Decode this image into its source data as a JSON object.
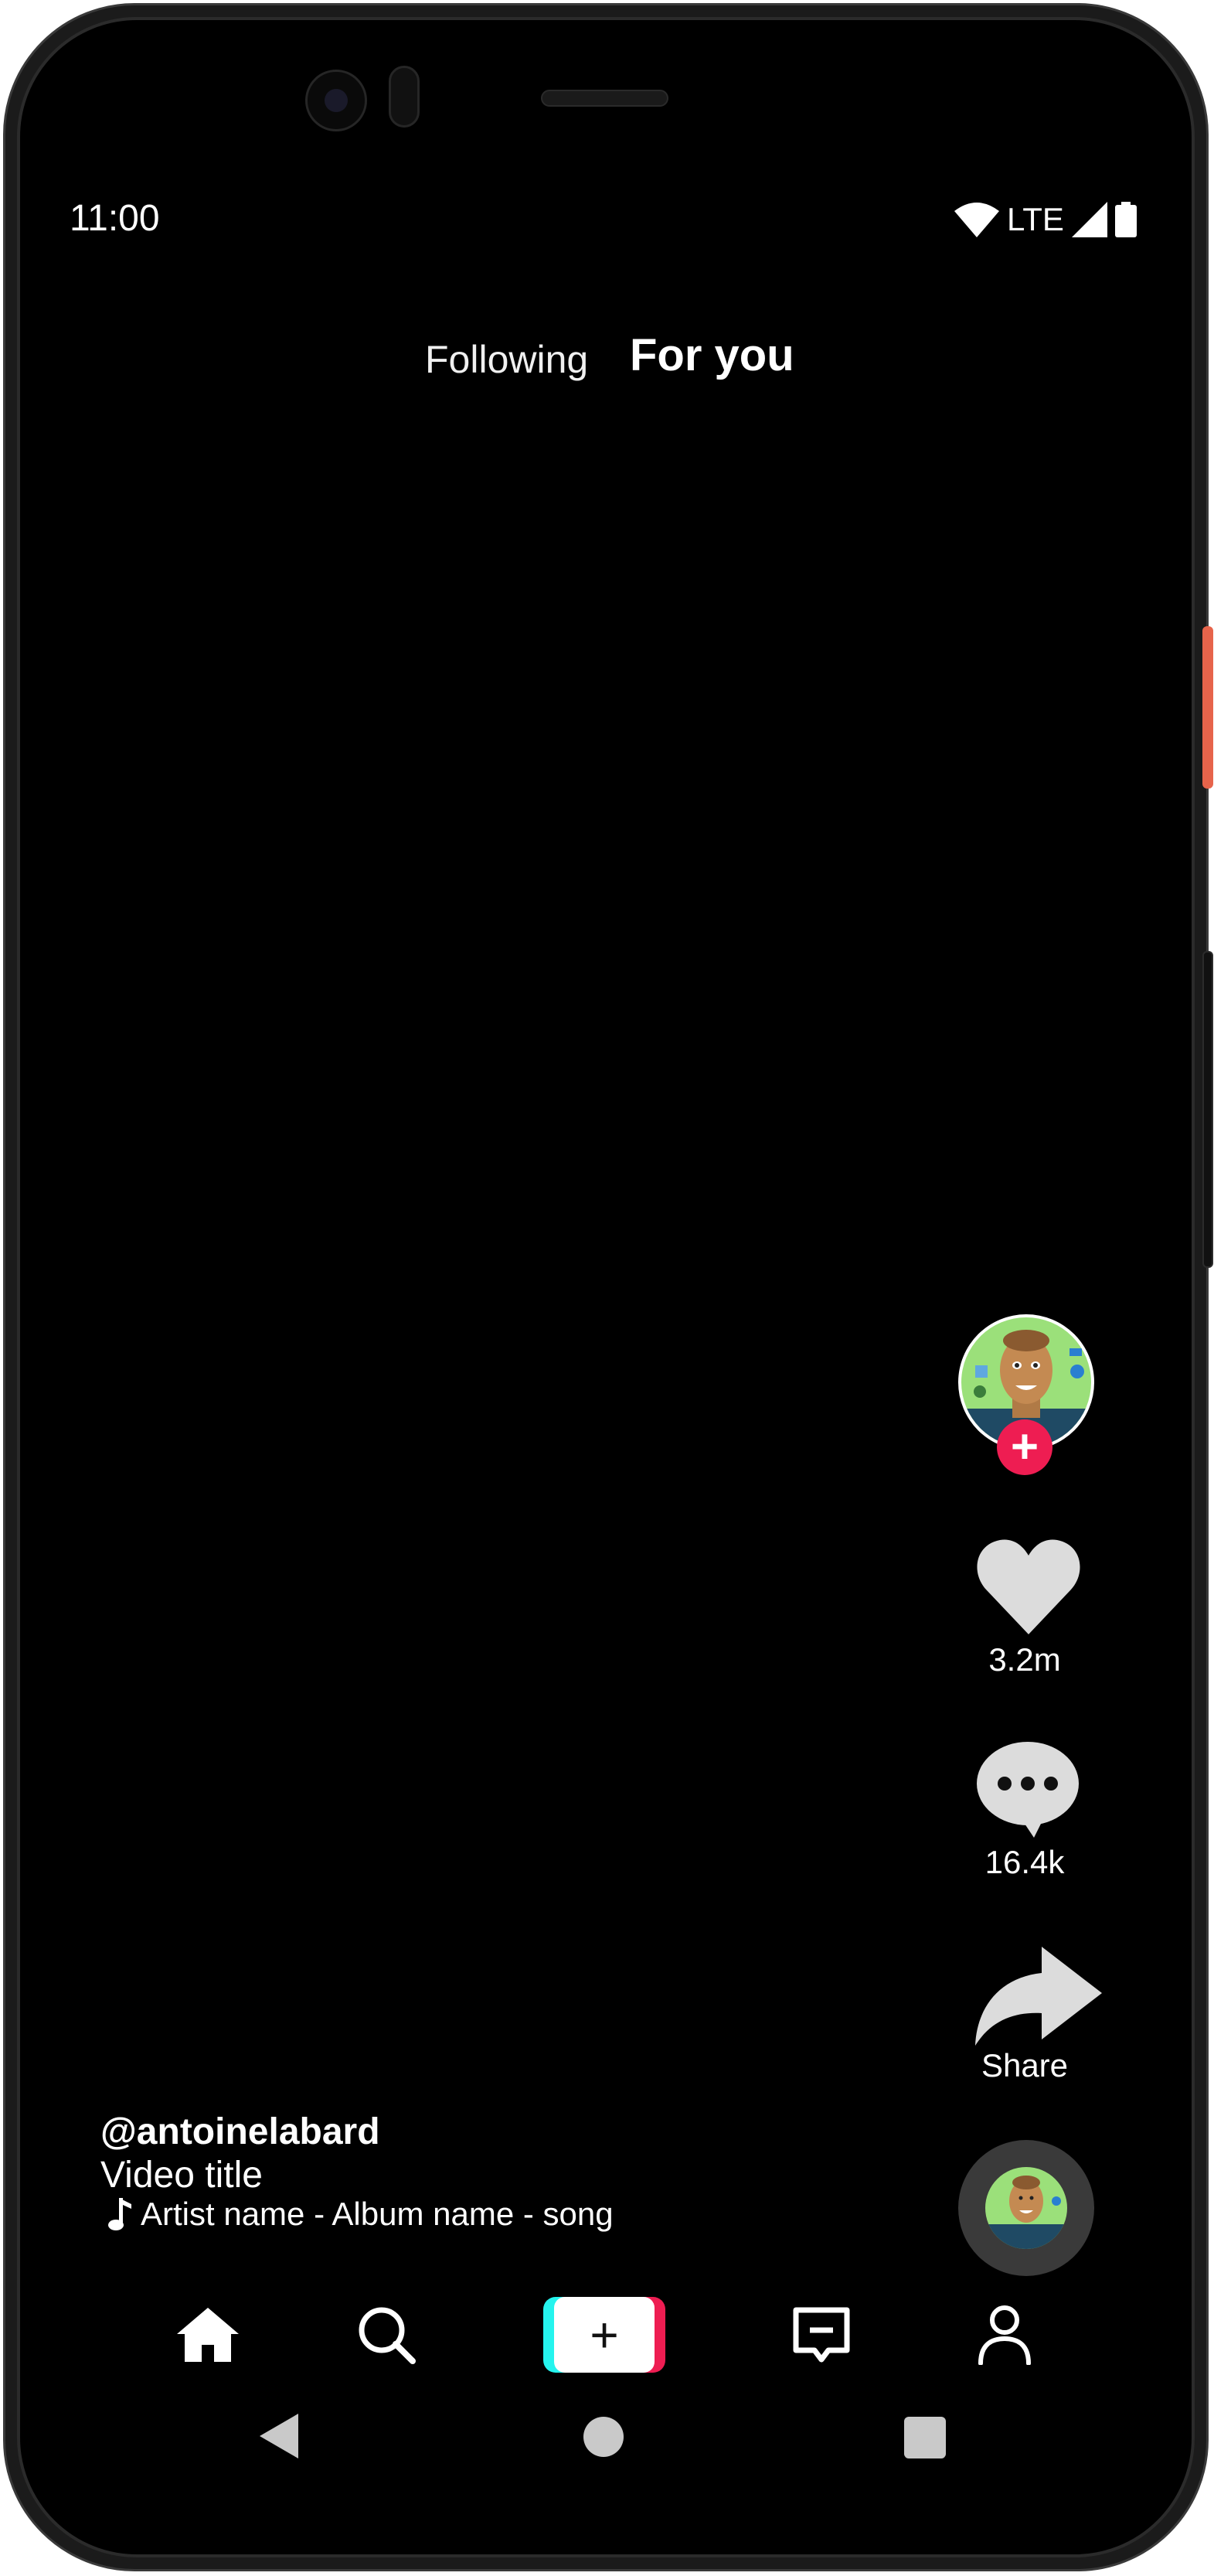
{
  "status_bar": {
    "time": "11:00",
    "network": "LTE"
  },
  "top_tabs": {
    "following": "Following",
    "for_you": "For you",
    "active": "For you"
  },
  "rail": {
    "follow_symbol": "+",
    "like_count": "3.2m",
    "comment_count": "16.4k",
    "share_label": "Share"
  },
  "caption": {
    "username": "@antoinelabard",
    "video_title": "Video title",
    "song": "Artist name - Album name - song"
  },
  "colors": {
    "accent_red": "#ee1d52",
    "accent_cyan": "#25f4ee",
    "icon_gray": "#dcdcdc",
    "power_button": "#e7644b"
  },
  "bottom_nav": {
    "items": [
      "home-icon",
      "search-icon",
      "create-icon",
      "inbox-icon",
      "profile-icon"
    ],
    "create_symbol": "+"
  },
  "system_nav": {
    "items": [
      "back-icon",
      "home-circle-icon",
      "recents-icon"
    ]
  }
}
